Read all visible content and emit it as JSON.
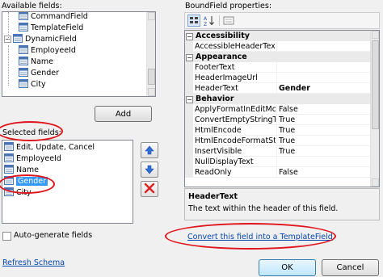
{
  "available_fields": {
    "label": "Available fields:",
    "items": [
      {
        "label": "CommandField",
        "indent": 1
      },
      {
        "label": "TemplateField",
        "indent": 1
      },
      {
        "label": "DynamicField",
        "indent": 0
      },
      {
        "label": "EmployeeId",
        "indent": 1
      },
      {
        "label": "Name",
        "indent": 1
      },
      {
        "label": "Gender",
        "indent": 1
      },
      {
        "label": "City",
        "indent": 1
      }
    ],
    "add_label": "Add"
  },
  "selected_fields": {
    "label": "Selected fields:",
    "items": [
      {
        "label": "Edit, Update, Cancel"
      },
      {
        "label": "EmployeeId"
      },
      {
        "label": "Name"
      },
      {
        "label": "Gender"
      },
      {
        "label": "City"
      }
    ],
    "selected_index": 3
  },
  "auto_generate": {
    "label": "Auto-generate fields",
    "checked": false
  },
  "refresh_label": "Refresh Schema",
  "properties": {
    "label": "BoundField properties:",
    "rows": [
      {
        "type": "cat",
        "name": "Accessibility"
      },
      {
        "type": "prop",
        "name": "AccessibleHeaderText",
        "value": ""
      },
      {
        "type": "cat",
        "name": "Appearance"
      },
      {
        "type": "prop",
        "name": "FooterText",
        "value": ""
      },
      {
        "type": "prop",
        "name": "HeaderImageUrl",
        "value": ""
      },
      {
        "type": "prop",
        "name": "HeaderText",
        "value": "Gender",
        "bold": true
      },
      {
        "type": "cat",
        "name": "Behavior"
      },
      {
        "type": "prop",
        "name": "ApplyFormatInEditMode",
        "value": "False"
      },
      {
        "type": "prop",
        "name": "ConvertEmptyStringToNull",
        "value": "True"
      },
      {
        "type": "prop",
        "name": "HtmlEncode",
        "value": "True"
      },
      {
        "type": "prop",
        "name": "HtmlEncodeFormatString",
        "value": "True"
      },
      {
        "type": "prop",
        "name": "InsertVisible",
        "value": "True"
      },
      {
        "type": "prop",
        "name": "NullDisplayText",
        "value": ""
      },
      {
        "type": "prop",
        "name": "ReadOnly",
        "value": "False"
      }
    ],
    "description_title": "HeaderText",
    "description_text": "The text within the header of this field."
  },
  "convert_link": "Convert this field into a TemplateField",
  "ok_label": "OK",
  "cancel_label": "Cancel",
  "colors": {
    "highlight": "#3399ff",
    "annotation": "#e0141c",
    "link": "#0645ad"
  }
}
